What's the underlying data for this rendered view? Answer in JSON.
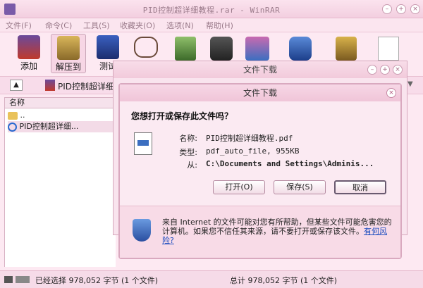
{
  "window": {
    "title": "PID控制超详细教程.rar - WinRAR"
  },
  "menu": [
    "文件(F)",
    "命令(C)",
    "工具(S)",
    "收藏夹(O)",
    "选项(N)",
    "帮助(H)"
  ],
  "toolbar": {
    "add": "添加",
    "extract": "解压到",
    "test": "测试"
  },
  "path": {
    "label": "PID控制超详细"
  },
  "list": {
    "header": "名称",
    "rows": [
      "..",
      "PID控制超详细..."
    ]
  },
  "status": {
    "left": "已经选择 978,052 字节 (1 个文件)",
    "right": "总计 978,052 字节 (1 个文件)"
  },
  "outer_dialog": {
    "title": "文件下载"
  },
  "dialog": {
    "title": "文件下载",
    "question": "您想打开或保存此文件吗？",
    "name_label": "名称:",
    "name_value": "PID控制超详细教程.pdf",
    "type_label": "类型:",
    "type_value": "pdf_auto_file, 955KB",
    "from_label": "从:",
    "from_value": "C:\\Documents and Settings\\Adminis...",
    "open_btn": "打开(O)",
    "save_btn": "保存(S)",
    "cancel_btn": "取消",
    "warning": "来自 Internet 的文件可能对您有所帮助，但某些文件可能危害您的计算机。如果您不信任其来源，请不要打开或保存该文件。",
    "risk_link": "有何风险?"
  },
  "colors": {
    "accent": "#f3cfe0",
    "link": "#1a4bbf"
  }
}
